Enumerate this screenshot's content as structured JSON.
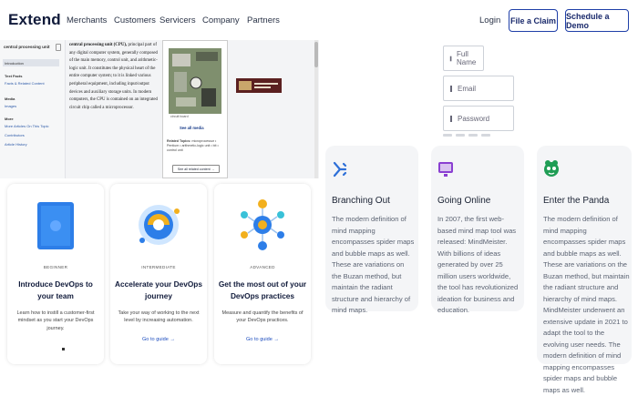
{
  "nav": {
    "logo": "Extend",
    "links": [
      "Merchants",
      "Customers",
      "Servicers",
      "Company",
      "Partners"
    ],
    "login": "Login",
    "file_claim": "File a Claim",
    "schedule_demo": "Schedule a Demo"
  },
  "wiki": {
    "toc_title": "central processing unit",
    "toc_items": [
      "Introduction",
      "Text Facts",
      "Facts & Related Content",
      "Media",
      "Images",
      "More",
      "More Articles On This Topic",
      "Contributors",
      "Article History"
    ],
    "body_lead": "central processing unit (CPU),",
    "body": " principal part of any digital computer system, generally composed of the main memory, control unit, and arithmetic-logic unit. It constitutes the physical heart of the entire computer system; to it is linked various peripheral equipment, including input/output devices and auxiliary storage units. In modern computers, the CPU is contained on an integrated circuit chip called a microprocessor.",
    "caption": "circuit board",
    "see_media": "See all media",
    "related_label": "Related Topics:",
    "related": "microprocessor • Pentium • arithmetic-logic unit • bit • control unit",
    "see_all": "See all related content →"
  },
  "form": {
    "full_name": "Full Name",
    "email": "Email",
    "password": "Password"
  },
  "mind_cards": [
    {
      "title": "Branching Out",
      "icon": "branch-icon",
      "text": "The modern definition of mind mapping encompasses spider maps and bubble maps as well. These are variations on the Buzan method, but maintain the radiant structure and hierarchy of mind maps."
    },
    {
      "title": "Going Online",
      "icon": "monitor-icon",
      "text": "In 2007, the first web-based mind map tool was released: MindMeister. With billions of ideas generated by over 25 million users worldwide, the tool has revolutionized ideation for business and education."
    },
    {
      "title": "Enter the Panda",
      "icon": "panda-icon",
      "text": "The modern definition of mind mapping encompasses spider maps and bubble maps as well. These are variations on the Buzan method, but maintain the radiant structure and hierarchy of mind maps. MindMeister underwent an extensive update in 2021 to adapt the tool to the evolving user needs. The modern definition of mind mapping encompasses spider maps and bubble maps as well."
    }
  ],
  "devops_cards": [
    {
      "tag": "BEGINNER",
      "title": "Introduce DevOps to your team",
      "text": "Learn how to instill a customer-first mindset as you start your DevOps journey.",
      "link": ""
    },
    {
      "tag": "INTERMEDIATE",
      "title": "Accelerate your DevOps journey",
      "text": "Take your way of working to the next level by increasing automation.",
      "link": "Go to guide →"
    },
    {
      "tag": "ADVANCED",
      "title": "Get the most out of your DevOps practices",
      "text": "Measure and quantify the benefits of your DevOps practices.",
      "link": "Go to guide →"
    }
  ],
  "colors": {
    "accent": "#1f3fa8",
    "icon_blue": "#2d6fd8",
    "icon_purple": "#8a3fd1",
    "icon_green": "#1f9d55"
  }
}
